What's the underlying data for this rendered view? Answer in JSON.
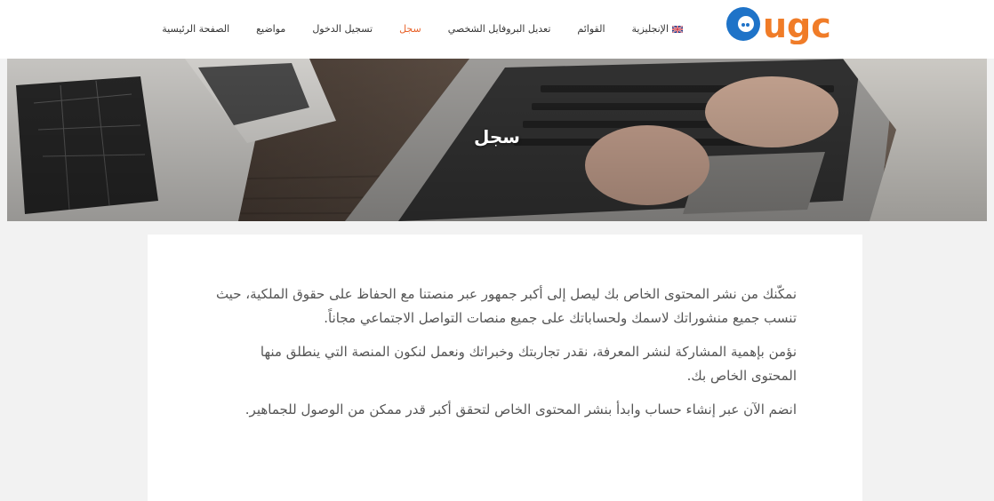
{
  "header": {
    "logo_text": "ugc",
    "nav": [
      {
        "label": "الصفحة الرئيسية"
      },
      {
        "label": "مواضيع"
      },
      {
        "label": "تسجيل الدخول"
      },
      {
        "label": "سجل",
        "active": true
      },
      {
        "label": "تعديل البروفايل الشخصي"
      },
      {
        "label": "القوائم"
      },
      {
        "label": "الإنجليزية",
        "icon": "uk-flag-icon"
      }
    ]
  },
  "hero": {
    "title": "سجل"
  },
  "content": {
    "paragraphs": [
      "نمكّنك من نشر المحتوى الخاص بك ليصل إلى أكبر جمهور عبر منصتنا مع الحفاظ على حقوق الملكية، حيث تنسب جميع منشوراتك لاسمك ولحساباتك على جميع منصات التواصل الاجتماعي مجاناً.",
      "نؤمن بإهمية المشاركة لنشر المعرفة، نقدر تجاربتك وخبراتك ونعمل لنكون المنصة التي ينطلق منها المحتوى الخاص بك.",
      "انضم الآن عبر إنشاء حساب وابدأ بنشر المحتوى الخاص لتحقق أكبر قدر ممكن من الوصول للجماهير."
    ]
  },
  "colors": {
    "accent": "#e8642c",
    "logo_blue": "#1e73c8",
    "logo_orange": "#f07c28"
  }
}
